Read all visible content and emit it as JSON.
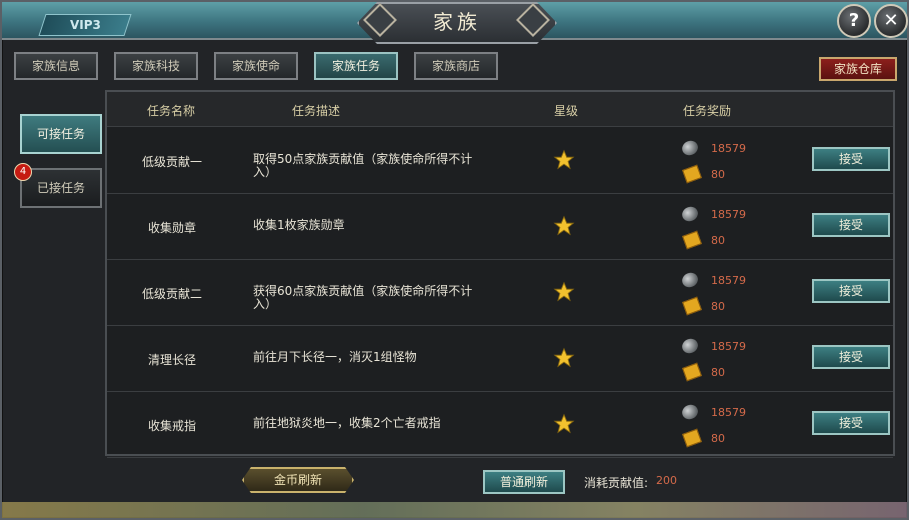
{
  "window": {
    "title": "家族",
    "vip_label": "VIP3",
    "bg_text_left": "...",
    "bg_text_right": "...",
    "help_symbol": "?",
    "close_symbol": "✕"
  },
  "tabs": [
    {
      "label": "家族信息",
      "active": false
    },
    {
      "label": "家族科技",
      "active": false
    },
    {
      "label": "家族使命",
      "active": false
    },
    {
      "label": "家族任务",
      "active": true
    },
    {
      "label": "家族商店",
      "active": false
    }
  ],
  "warehouse_label": "家族仓库",
  "side": {
    "available_label": "可接任务",
    "accepted_label": "已接任务",
    "accepted_badge": "4"
  },
  "table": {
    "headers": {
      "name": "任务名称",
      "desc": "任务描述",
      "stars": "星级",
      "reward": "任务奖励"
    },
    "rows": [
      {
        "name": "低级贡献一",
        "desc": "取得50点家族贡献值（家族使命所得不计入）",
        "stars": 1,
        "coin": "18579",
        "ticket": "80",
        "action": "接受"
      },
      {
        "name": "收集勋章",
        "desc": "收集1枚家族勋章",
        "stars": 1,
        "coin": "18579",
        "ticket": "80",
        "action": "接受"
      },
      {
        "name": "低级贡献二",
        "desc": "获得60点家族贡献值（家族使命所得不计入）",
        "stars": 1,
        "coin": "18579",
        "ticket": "80",
        "action": "接受"
      },
      {
        "name": "清理长径",
        "desc": "前往月下长径一，消灭1组怪物",
        "stars": 1,
        "coin": "18579",
        "ticket": "80",
        "action": "接受"
      },
      {
        "name": "收集戒指",
        "desc": "前往地狱炎地一，收集2个亡者戒指",
        "stars": 1,
        "coin": "18579",
        "ticket": "80",
        "action": "接受"
      }
    ]
  },
  "footer": {
    "gold_refresh": "金币刷新",
    "normal_refresh": "普通刷新",
    "cost_label": "消耗贡献值:",
    "cost_value": "200"
  },
  "colors": {
    "accent_teal": "#3d7f82",
    "reward_value": "#d46a4a",
    "warehouse_red": "#8c1f1c",
    "star_gold": "#f2c12e"
  }
}
